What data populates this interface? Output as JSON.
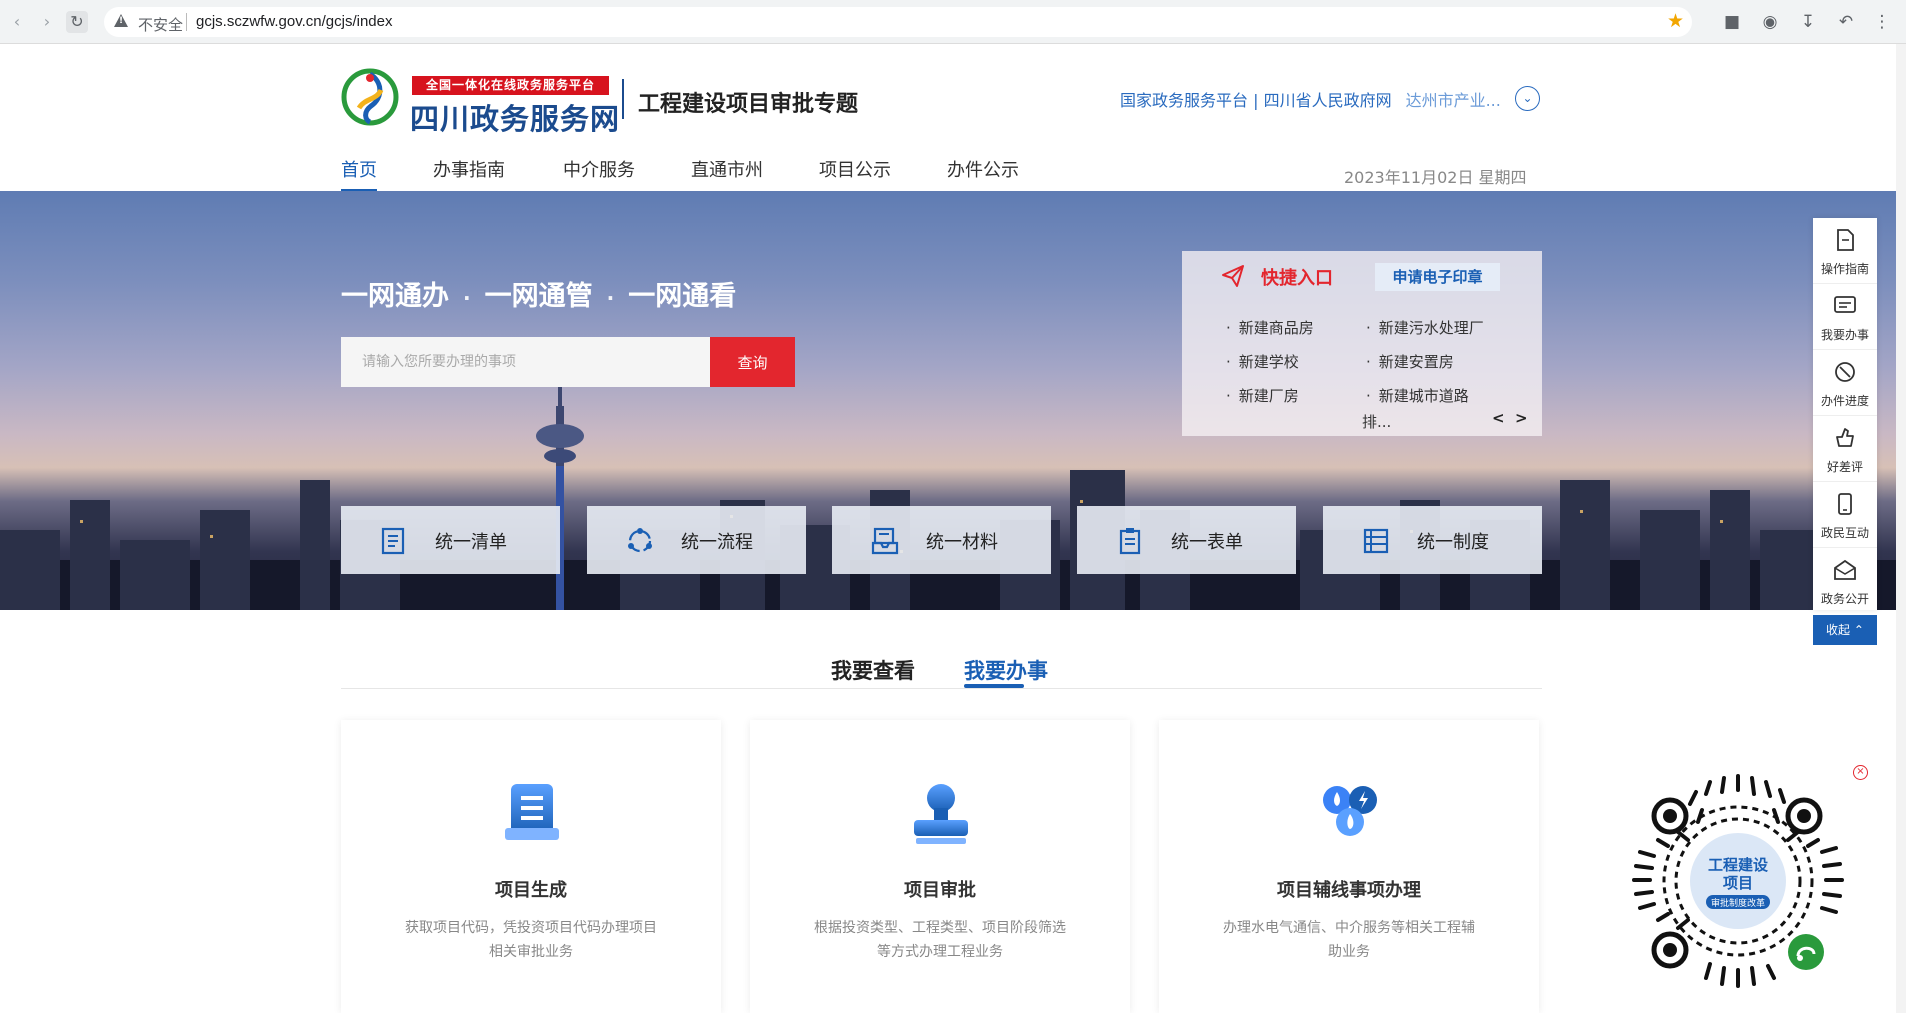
{
  "browser": {
    "insecure_label": "不安全",
    "url": "gcjs.sczwfw.gov.cn/gcjs/index"
  },
  "header": {
    "badge": "全国一体化在线政务服务平台",
    "site_name": "四川政务服务网",
    "subtitle": "工程建设项目审批专题",
    "links": "国家政务服务平台 | 四川省人民政府网",
    "city": "达州市产业...",
    "date": "2023年11月02日 星期四"
  },
  "nav": [
    {
      "label": "首页",
      "active": true
    },
    {
      "label": "办事指南"
    },
    {
      "label": "中介服务"
    },
    {
      "label": "直通市州"
    },
    {
      "label": "项目公示"
    },
    {
      "label": "办件公示"
    }
  ],
  "banner": {
    "slogan": [
      "一网通办",
      "一网通管",
      "一网通看"
    ],
    "search_placeholder": "请输入您所要办理的事项",
    "search_button": "查询"
  },
  "quick": {
    "title": "快捷入口",
    "stamp": "申请电子印章",
    "items": [
      "新建商品房",
      "新建污水处理厂",
      "新建学校",
      "新建安置房",
      "新建厂房",
      "新建城市道路"
    ],
    "more": "排...",
    "prev": "<",
    "next": ">"
  },
  "unify": [
    "统一清单",
    "统一流程",
    "统一材料",
    "统一表单",
    "统一制度"
  ],
  "sidebar": {
    "items": [
      "操作指南",
      "我要办事",
      "办件进度",
      "好差评",
      "政民互动",
      "政务公开"
    ],
    "collapse": "收起"
  },
  "tabs": [
    {
      "label": "我要查看"
    },
    {
      "label": "我要办事",
      "active": true
    }
  ],
  "cards": [
    {
      "title": "项目生成",
      "desc": "获取项目代码，凭投资项目代码办理项目相关审批业务"
    },
    {
      "title": "项目审批",
      "desc": "根据投资类型、工程类型、项目阶段筛选等方式办理工程业务"
    },
    {
      "title": "项目辅线事项办理",
      "desc": "办理水电气通信、中介服务等相关工程辅助业务"
    }
  ],
  "qr": {
    "line1": "工程建设",
    "line2": "项目",
    "tag": "审批制度改革"
  },
  "colors": {
    "primary": "#1a5fb4",
    "accent": "#e3262e"
  }
}
